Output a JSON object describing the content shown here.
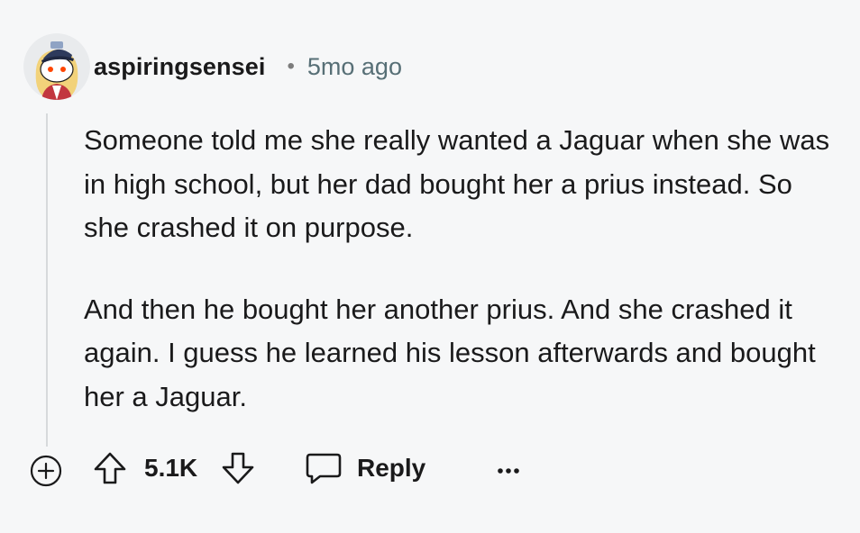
{
  "comment": {
    "username": "aspiringsensei",
    "separator": "•",
    "time": "5mo ago",
    "avatar_icon": "snoo-avatar-icon",
    "paragraphs": [
      "Someone told me she really wanted a Jaguar when she was in high school, but her dad bought her a prius instead. So she crashed it on purpose.",
      "And then he bought her another prius. And she crashed it again. I guess he learned his lesson afterwards and bought her a Jaguar."
    ]
  },
  "actions": {
    "expand_icon": "plus-circle-icon",
    "upvote_icon": "arrow-up-icon",
    "score": "5.1K",
    "downvote_icon": "arrow-down-icon",
    "reply_icon": "speech-bubble-icon",
    "reply_label": "Reply",
    "more_icon": "ellipsis-icon"
  },
  "colors": {
    "background": "#f6f7f8",
    "text": "#1a1a1b",
    "meta": "#576f76",
    "thread_line": "#d7dadc"
  }
}
